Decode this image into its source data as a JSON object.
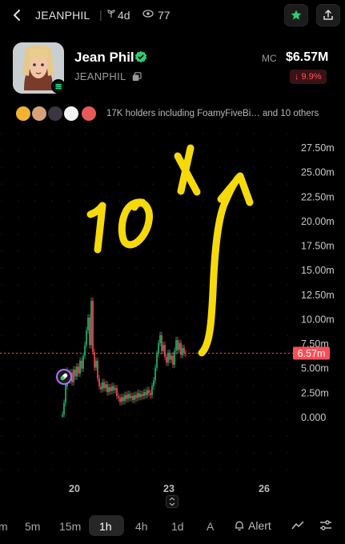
{
  "topbar": {
    "ticker": "JEANPHIL",
    "separator": "|",
    "age": "4d",
    "views": "77"
  },
  "token": {
    "name": "Jean Phil",
    "symbol": "JEANPHIL",
    "mc_label": "MC",
    "mc_value": "$6.57M",
    "change": "↓ 9.9%"
  },
  "holders": {
    "text": "17K holders including FoamyFiveBi… and 10 others"
  },
  "chart": {
    "y_ticks": [
      "27.50m",
      "25.00m",
      "22.50m",
      "20.00m",
      "17.50m",
      "15.00m",
      "12.50m",
      "10.00m",
      "7.50m",
      "5.00m",
      "2.50m",
      "0.000"
    ],
    "x_ticks": [
      "20",
      "23",
      "26"
    ],
    "price_tag": "6.57m",
    "annotation": "10x"
  },
  "chart_data": {
    "type": "candlestick",
    "ylim": [
      0,
      27.5
    ],
    "y_unit": "m",
    "current_value": 6.57,
    "x_ticks": [
      "20",
      "23",
      "26"
    ],
    "annotation": "10x"
  },
  "bottombar": {
    "timeframes": [
      "m",
      "5m",
      "15m",
      "1h",
      "4h",
      "1d",
      "A"
    ],
    "active": "1h",
    "alert": "Alert"
  },
  "colors": {
    "up": "#1fbf75",
    "down": "#ff4d57",
    "price_line": "#ff4d57",
    "annotation": "#f5d90a",
    "accent": "#2ecc71"
  }
}
